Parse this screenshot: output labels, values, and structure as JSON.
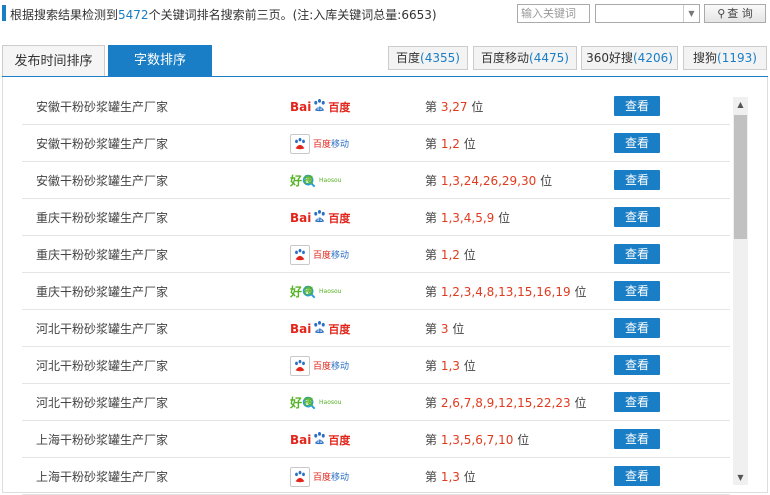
{
  "summary": {
    "prefix": "根据搜索结果检测到",
    "count": "5472",
    "suffix": "个关键词排名搜索前三页。(注:入库关键词总量:6653)"
  },
  "search": {
    "placeholder": "输入关键词",
    "button_label": "查 询",
    "selected_engine": ""
  },
  "tabs": {
    "time_label": "发布时间排序",
    "count_label": "字数排序"
  },
  "engines": [
    {
      "name": "百度",
      "count": "(4355)"
    },
    {
      "name": "百度移动",
      "count": "(4475)"
    },
    {
      "name": "360好搜",
      "count": "(4206)"
    },
    {
      "name": "搜狗",
      "count": "(1193)"
    }
  ],
  "logos": {
    "baidu_text_1": "Bai",
    "baidu_text_2": "百度",
    "mobile_text_1": "百度",
    "mobile_text_2": "移动",
    "haosou_text_1": "好",
    "haosou_text_2": "搜",
    "haosou_text_3": "Haosou"
  },
  "rank_prefix": "第",
  "rank_suffix": "位",
  "view_label": "查看",
  "rows": [
    {
      "keyword": "安徽干粉砂浆罐生产厂家",
      "engine": "baidu",
      "ranks": "3,27"
    },
    {
      "keyword": "安徽干粉砂浆罐生产厂家",
      "engine": "mobile",
      "ranks": "1,2"
    },
    {
      "keyword": "安徽干粉砂浆罐生产厂家",
      "engine": "haosou",
      "ranks": "1,3,24,26,29,30"
    },
    {
      "keyword": "重庆干粉砂浆罐生产厂家",
      "engine": "baidu",
      "ranks": "1,3,4,5,9"
    },
    {
      "keyword": "重庆干粉砂浆罐生产厂家",
      "engine": "mobile",
      "ranks": "1,2"
    },
    {
      "keyword": "重庆干粉砂浆罐生产厂家",
      "engine": "haosou",
      "ranks": "1,2,3,4,8,13,15,16,19"
    },
    {
      "keyword": "河北干粉砂浆罐生产厂家",
      "engine": "baidu",
      "ranks": "3"
    },
    {
      "keyword": "河北干粉砂浆罐生产厂家",
      "engine": "mobile",
      "ranks": "1,3"
    },
    {
      "keyword": "河北干粉砂浆罐生产厂家",
      "engine": "haosou",
      "ranks": "2,6,7,8,9,12,15,22,23"
    },
    {
      "keyword": "上海干粉砂浆罐生产厂家",
      "engine": "baidu",
      "ranks": "1,3,5,6,7,10"
    },
    {
      "keyword": "上海干粉砂浆罐生产厂家",
      "engine": "mobile",
      "ranks": "1,3"
    }
  ],
  "colors": {
    "accent": "#1a7ec6",
    "rank": "#e03a1e",
    "baidu": "#e1251b",
    "haosou": "#56b326"
  }
}
